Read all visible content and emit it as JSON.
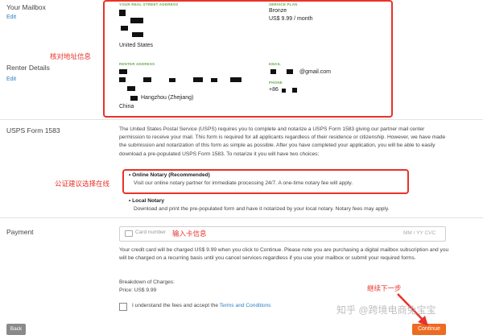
{
  "sections": {
    "mailbox": {
      "label": "Your Mailbox",
      "edit": "Edit"
    },
    "renter": {
      "label": "Renter Details",
      "edit": "Edit"
    },
    "usps": {
      "label": "USPS Form 1583"
    },
    "payment": {
      "label": "Payment"
    }
  },
  "address_card": {
    "street_label": "YOUR REAL STREET ADDRESS",
    "street_country": "United States",
    "service_label": "SERVICE PLAN",
    "service_plan": "Bronze",
    "service_price": "US$ 9.99 / month",
    "renter_label": "RENTER ADDRESS",
    "renter_city": "Hangzhou (Zhejiang)",
    "renter_country": "China",
    "email_label": "EMAIL",
    "email_value": "@gmail.com",
    "phone_label": "PHONE",
    "phone_value": "+86"
  },
  "annotations": {
    "address_check": "核对地址信息",
    "notary_advice": "公证建议选择在线",
    "card_input": "输入卡信息",
    "continue_next": "继续下一步"
  },
  "usps_text": "The United States Postal Service (USPS) requires you to complete and notarize a USPS Form 1583 giving our partner mail center permission to receive your mail. This form is required for all applicants regardless of their residence or citizenship. However, we have made the submission and notarization of this form as simple as possible. After you have completed your application, you will be able to easily download a pre-populated USPS Form 1583. To notarize it you will have two choices:",
  "notary_options": [
    {
      "title": "Online Notary (Recommended)",
      "desc": "Visit our online notary partner for immediate processing 24/7. A one-time notary fee will apply."
    },
    {
      "title": "Local Notary",
      "desc": "Download and print the pre-populated form and have it notarized by your local notary. Notary fees may apply."
    }
  ],
  "payment": {
    "card_placeholder": "Card number",
    "expiry_cvc": "MM / YY  CVC",
    "notice": "Your credit card will be charged US$ 9.99 when you click to Continue. Please note you are purchasing a digital mailbox subscription and you will be charged on a recurring basis until you cancel services regardless if you use your mailbox or submit your required forms.",
    "breakdown_title": "Breakdown of Charges:",
    "price_line": "Price: US$ 9.99",
    "agree_text": "I understand the fees and accept the ",
    "terms_link": "Terms and Conditions"
  },
  "buttons": {
    "back": "Back",
    "continue": "Continue"
  },
  "watermark": "知乎 @跨境电商兔宝宝",
  "colors": {
    "accent": "#ee6b22",
    "annotation": "#e8322a",
    "link": "#2a7fc0",
    "label_green": "#6aa84f"
  }
}
